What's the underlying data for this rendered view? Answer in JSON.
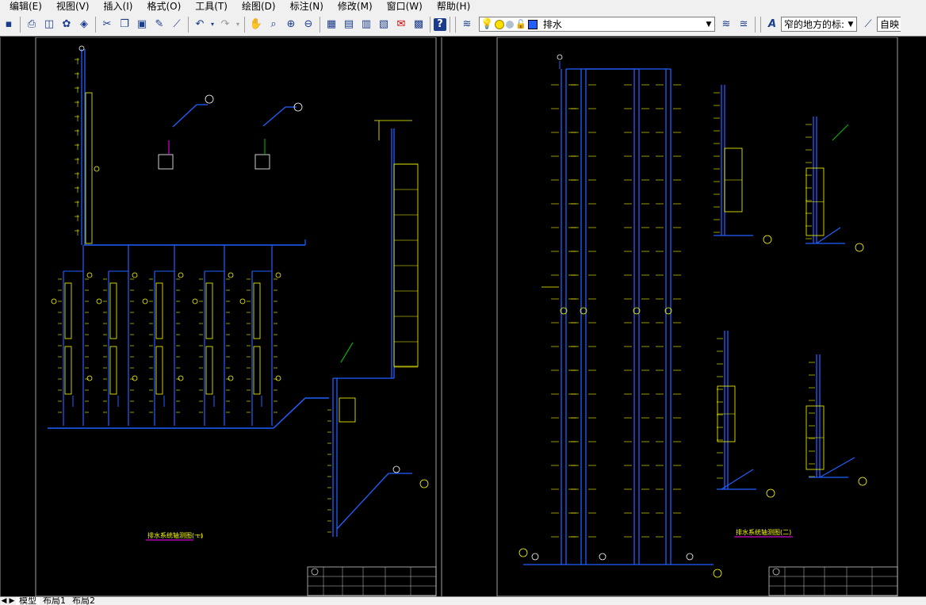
{
  "menu": [
    "编辑(E)",
    "视图(V)",
    "插入(I)",
    "格式(O)",
    "工具(T)",
    "绘图(D)",
    "标注(N)",
    "修改(M)",
    "窗口(W)",
    "帮助(H)"
  ],
  "toolbar": {
    "layer_name": "排水",
    "text_style": "窄的地方的标:",
    "dim_style": "自映"
  },
  "drawings": {
    "left_title": "排水系统轴测图(一)",
    "right_title": "排水系统轴测图(二)"
  },
  "tabs": {
    "model": "模型",
    "layout1": "布局1",
    "layout2": "布局2"
  },
  "colors": {
    "pipe": "#2060ff",
    "label": "#ffff00",
    "frame": "#c8c8c8",
    "accent_green": "#00c000",
    "accent_magenta": "#ff00ff"
  }
}
